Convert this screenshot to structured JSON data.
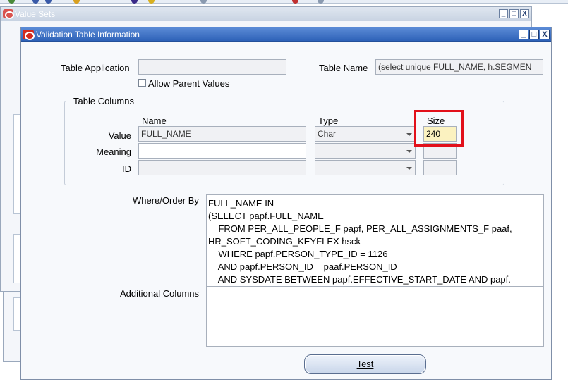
{
  "background_window": {
    "title": "Value Sets",
    "controls": [
      "_",
      "□",
      "X"
    ]
  },
  "dialog": {
    "title": "Validation Table Information",
    "controls": [
      "_",
      "□",
      "X"
    ]
  },
  "table_application": {
    "label": "Table Application",
    "value": ""
  },
  "allow_parent_values": {
    "label": "Allow Parent Values",
    "checked": false
  },
  "table_name": {
    "label": "Table Name",
    "value": "(select unique FULL_NAME, h.SEGMEN"
  },
  "table_columns": {
    "group_title": "Table Columns",
    "headers": {
      "name": "Name",
      "type": "Type",
      "size": "Size"
    },
    "rows": [
      {
        "label": "Value",
        "name": "FULL_NAME",
        "type": "Char",
        "size": "240"
      },
      {
        "label": "Meaning",
        "name": "",
        "type": "",
        "size": ""
      },
      {
        "label": "ID",
        "name": "",
        "type": "",
        "size": ""
      }
    ]
  },
  "where_order_by": {
    "label": "Where/Order By",
    "lines": [
      "FULL_NAME IN",
      "(SELECT papf.FULL_NAME",
      "    FROM PER_ALL_PEOPLE_F papf, PER_ALL_ASSIGNMENTS_F paaf,",
      "HR_SOFT_CODING_KEYFLEX hsck",
      "    WHERE papf.PERSON_TYPE_ID = 1126",
      "    AND papf.PERSON_ID = paaf.PERSON_ID",
      "    AND SYSDATE BETWEEN papf.EFFECTIVE_START_DATE AND papf."
    ]
  },
  "additional_columns": {
    "label": "Additional Columns",
    "value": ""
  },
  "test_button": {
    "label": "Test"
  },
  "colors": {
    "titlebar": "#2e62b8",
    "highlight": "#e2101a",
    "size_field": "#fbf2c0",
    "oracle_icon": "#d42a1e"
  }
}
